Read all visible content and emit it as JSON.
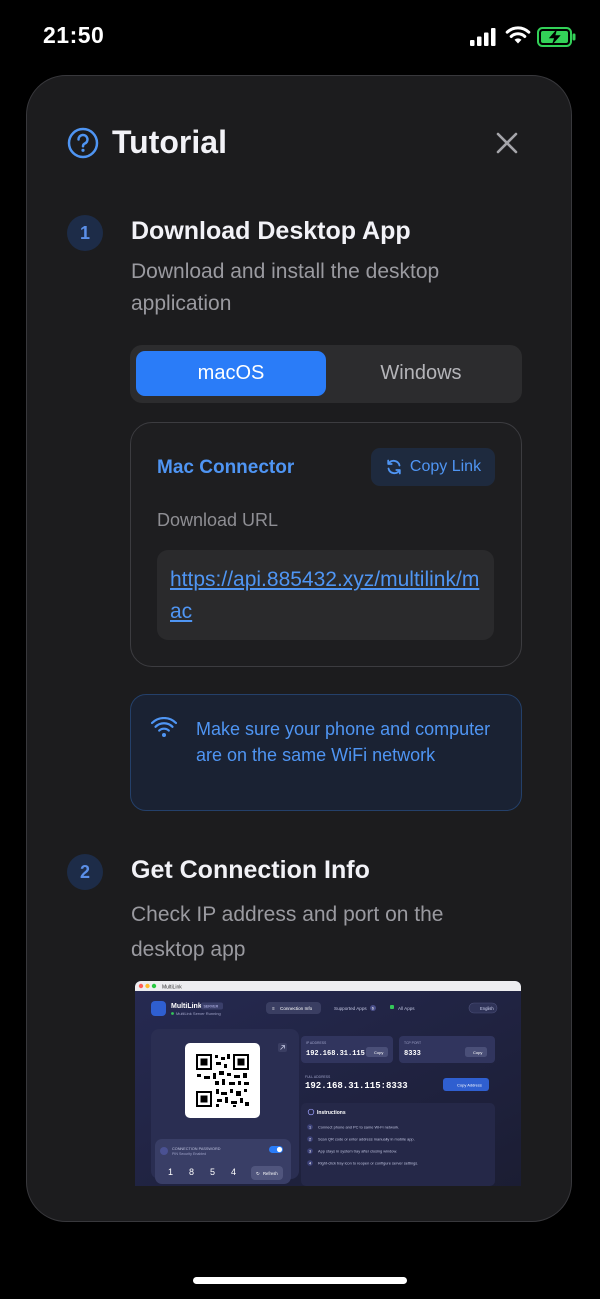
{
  "status_bar": {
    "time": "21:50"
  },
  "modal": {
    "title": "Tutorial",
    "steps": [
      {
        "number": "1",
        "title": "Download Desktop App",
        "description": "Download and install the desktop application"
      },
      {
        "number": "2",
        "title": "Get Connection Info",
        "description": "Check IP address and port on the desktop app"
      }
    ],
    "os_tabs": [
      {
        "label": "macOS",
        "selected": true
      },
      {
        "label": "Windows",
        "selected": false
      }
    ],
    "connector": {
      "title": "Mac Connector",
      "copy_label": "Copy Link",
      "download_label": "Download URL",
      "url": "https://api.885432.xyz/multilink/mac"
    },
    "wifi_notice": "Make sure your phone and computer are on the same WiFi network"
  },
  "desktop_screenshot": {
    "window_title": "MultiLink",
    "app_name": "MultiLink",
    "app_badge": "SERVER",
    "app_status": "MultiLink Server Running",
    "tabs": [
      "Connection Info",
      "Supported Apps",
      "All Apps"
    ],
    "supported_count": "6",
    "language": "English",
    "ip_label": "IP ADDRESS",
    "ip_value": "192.168.31.115",
    "port_label": "TCP PORT",
    "port_value": "8333",
    "copy": "Copy",
    "full_label": "FULL ADDRESS",
    "full_value": "192.168.31.115:8333",
    "copy_address": "Copy Address",
    "instructions_title": "Instructions",
    "instructions": [
      "Connect phone and PC to same Wi-Fi network.",
      "Scan QR code or enter address manually in mobile app.",
      "App stays in system tray after closing window.",
      "Right-click tray icon to reopen or configure server settings."
    ],
    "password_label": "CONNECTION PASSWORD",
    "password_sub": "PIN Security Enabled",
    "pin_digits": [
      "1",
      "8",
      "5",
      "4"
    ],
    "refresh": "Refresh"
  },
  "colors": {
    "accent": "#2a7cf8",
    "link": "#4f95f3",
    "card_bg": "#1c1c1e",
    "background": "#000000"
  }
}
